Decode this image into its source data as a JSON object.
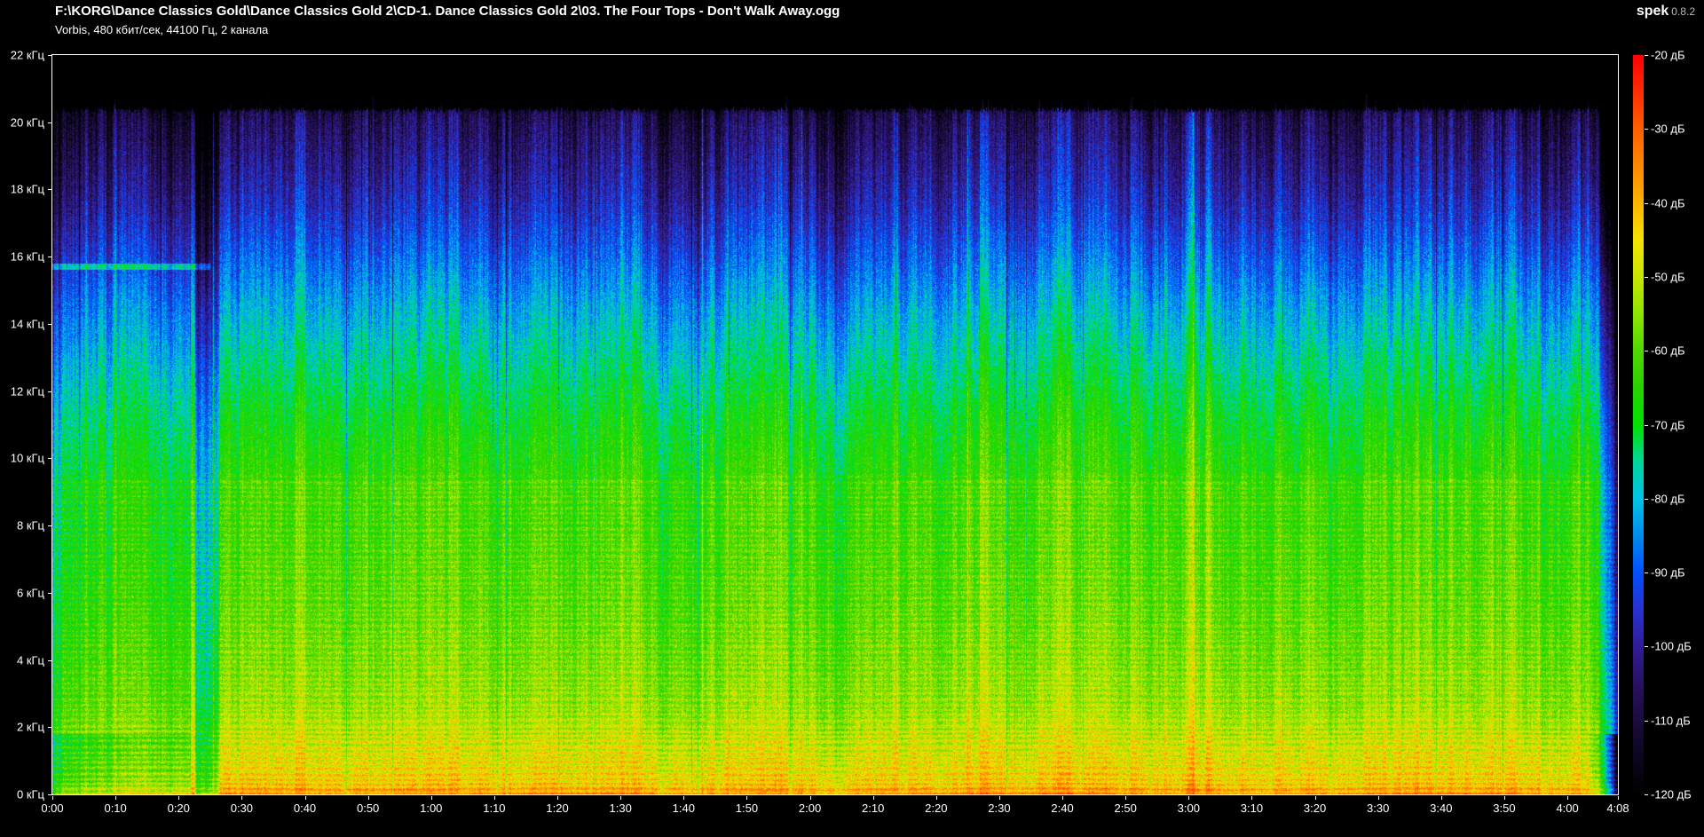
{
  "header": {
    "file_path": "F:\\KORG\\Dance Classics Gold\\Dance Classics Gold 2\\CD-1. Dance Classics Gold 2\\03. The Four Tops - Don't Walk Away.ogg",
    "stream_info": "Vorbis, 480 кбит/сек, 44100 Гц, 2 канала",
    "app_name": "spek",
    "app_version": "0.8.2"
  },
  "freq_axis": {
    "unit": "кГц",
    "ticks": [
      {
        "label": "22 кГц",
        "khz": 22
      },
      {
        "label": "20 кГц",
        "khz": 20
      },
      {
        "label": "18 кГц",
        "khz": 18
      },
      {
        "label": "16 кГц",
        "khz": 16
      },
      {
        "label": "14 кГц",
        "khz": 14
      },
      {
        "label": "12 кГц",
        "khz": 12
      },
      {
        "label": "10 кГц",
        "khz": 10
      },
      {
        "label": "8 кГц",
        "khz": 8
      },
      {
        "label": "6 кГц",
        "khz": 6
      },
      {
        "label": "4 кГц",
        "khz": 4
      },
      {
        "label": "2 кГц",
        "khz": 2
      },
      {
        "label": "0 кГц",
        "khz": 0
      }
    ]
  },
  "time_axis": {
    "ticks": [
      {
        "label": "0:00",
        "sec": 0
      },
      {
        "label": "0:10",
        "sec": 10
      },
      {
        "label": "0:20",
        "sec": 20
      },
      {
        "label": "0:30",
        "sec": 30
      },
      {
        "label": "0:40",
        "sec": 40
      },
      {
        "label": "0:50",
        "sec": 50
      },
      {
        "label": "1:00",
        "sec": 60
      },
      {
        "label": "1:10",
        "sec": 70
      },
      {
        "label": "1:20",
        "sec": 80
      },
      {
        "label": "1:30",
        "sec": 90
      },
      {
        "label": "1:40",
        "sec": 100
      },
      {
        "label": "1:50",
        "sec": 110
      },
      {
        "label": "2:00",
        "sec": 120
      },
      {
        "label": "2:10",
        "sec": 130
      },
      {
        "label": "2:20",
        "sec": 140
      },
      {
        "label": "2:30",
        "sec": 150
      },
      {
        "label": "2:40",
        "sec": 160
      },
      {
        "label": "2:50",
        "sec": 170
      },
      {
        "label": "3:00",
        "sec": 180
      },
      {
        "label": "3:10",
        "sec": 190
      },
      {
        "label": "3:20",
        "sec": 200
      },
      {
        "label": "3:30",
        "sec": 210
      },
      {
        "label": "3:40",
        "sec": 220
      },
      {
        "label": "3:50",
        "sec": 230
      },
      {
        "label": "4:00",
        "sec": 240
      },
      {
        "label": "4:08",
        "sec": 248
      }
    ]
  },
  "db_axis": {
    "unit": "дБ",
    "ticks": [
      {
        "label": "-20 дБ",
        "db": -20
      },
      {
        "label": "-30 дБ",
        "db": -30
      },
      {
        "label": "-40 дБ",
        "db": -40
      },
      {
        "label": "-50 дБ",
        "db": -50
      },
      {
        "label": "-60 дБ",
        "db": -60
      },
      {
        "label": "-70 дБ",
        "db": -70
      },
      {
        "label": "-80 дБ",
        "db": -80
      },
      {
        "label": "-90 дБ",
        "db": -90
      },
      {
        "label": "-100 дБ",
        "db": -100
      },
      {
        "label": "-110 дБ",
        "db": -110
      },
      {
        "label": "-120 дБ",
        "db": -120
      }
    ]
  },
  "chart_data": {
    "type": "heatmap",
    "subtype": "audio-spectrogram",
    "duration_sec": 248,
    "freq_range_khz": [
      0,
      22
    ],
    "db_range": [
      -120,
      -20
    ],
    "lowpass_khz": 20.4,
    "legend_position": "right",
    "seed": 7,
    "palette": [
      [
        -120,
        "#000000"
      ],
      [
        -113,
        "#12082a"
      ],
      [
        -106,
        "#26105a"
      ],
      [
        -100,
        "#321c96"
      ],
      [
        -95,
        "#2832d2"
      ],
      [
        -90,
        "#0050ff"
      ],
      [
        -85,
        "#008cf0"
      ],
      [
        -80,
        "#00c3e6"
      ],
      [
        -75,
        "#00d79b"
      ],
      [
        -70,
        "#00e100"
      ],
      [
        -65,
        "#28d200"
      ],
      [
        -60,
        "#50d800"
      ],
      [
        -55,
        "#8ce600"
      ],
      [
        -50,
        "#c8e600"
      ],
      [
        -45,
        "#f5e300"
      ],
      [
        -40,
        "#ffb400"
      ],
      [
        -35,
        "#ff8700"
      ],
      [
        -30,
        "#ff5f00"
      ],
      [
        -25,
        "#ff2d00"
      ],
      [
        -20,
        "#ff0000"
      ]
    ],
    "band_profile_khz_db": [
      [
        0,
        -34
      ],
      [
        0.12,
        -38
      ],
      [
        0.35,
        -43
      ],
      [
        0.8,
        -45
      ],
      [
        1.5,
        -48
      ],
      [
        2.5,
        -53
      ],
      [
        4,
        -56
      ],
      [
        6,
        -59
      ],
      [
        8,
        -61
      ],
      [
        9.3,
        -61
      ],
      [
        9.6,
        -64
      ],
      [
        10.5,
        -66
      ],
      [
        11.5,
        -69
      ],
      [
        12.5,
        -73
      ],
      [
        13.5,
        -77
      ],
      [
        14.5,
        -81
      ],
      [
        15.5,
        -86
      ],
      [
        16.5,
        -91
      ],
      [
        17.5,
        -96
      ],
      [
        18.5,
        -100
      ],
      [
        19.3,
        -103
      ],
      [
        20,
        -106
      ],
      [
        20.35,
        -109
      ],
      [
        20.6,
        -120
      ],
      [
        22,
        -120
      ]
    ],
    "gain_events": [
      [
        0,
        -16
      ],
      [
        0.8,
        -11
      ],
      [
        2,
        -8
      ],
      [
        5,
        -6.5
      ],
      [
        10,
        -6
      ],
      [
        21.8,
        -6
      ],
      [
        22.05,
        7
      ],
      [
        22.45,
        7
      ],
      [
        22.8,
        -17
      ],
      [
        25.8,
        -17
      ],
      [
        26.6,
        0
      ],
      [
        240,
        0
      ],
      [
        243.5,
        -2
      ],
      [
        245,
        -9
      ],
      [
        246,
        -19
      ],
      [
        247,
        -33
      ],
      [
        248,
        -48
      ]
    ],
    "bass_gain_events": [
      [
        0,
        -11
      ],
      [
        9,
        -9
      ],
      [
        14,
        -6
      ],
      [
        22,
        -5
      ],
      [
        24,
        -2
      ],
      [
        26,
        0
      ],
      [
        242,
        0
      ],
      [
        245.5,
        -6
      ],
      [
        247,
        -18
      ],
      [
        248,
        -30
      ]
    ],
    "hf_line": {
      "khz": 15.72,
      "until_sec": 25,
      "boost_db": 16
    },
    "texture": {
      "stripe_db": 9,
      "slow_band_db": 1.8,
      "speckle_db": 13
    }
  }
}
